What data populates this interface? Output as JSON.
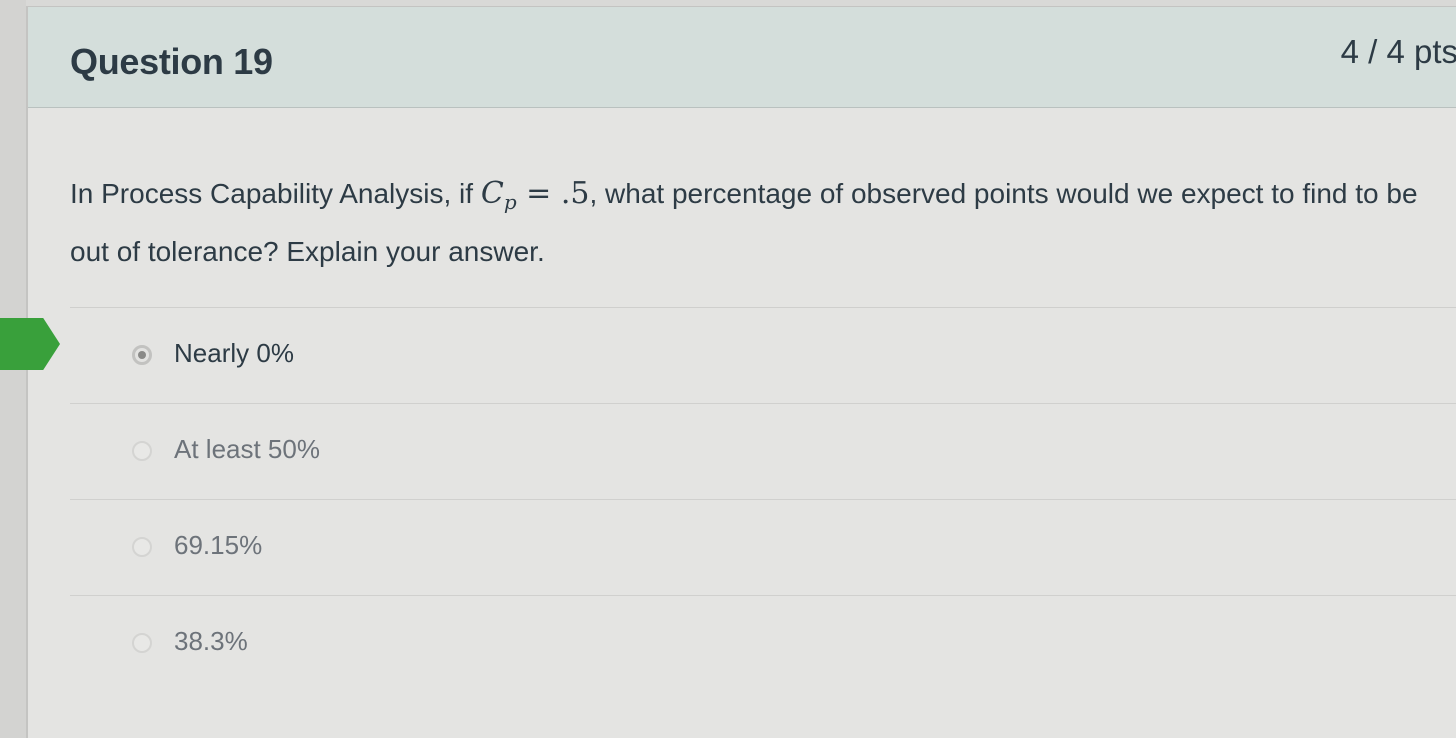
{
  "question": {
    "title": "Question 19",
    "points": "4 / 4 pts",
    "text_before_math": "In Process Capability Analysis, if ",
    "math_symbol": "C",
    "math_subscript": "p",
    "math_rest": " = .5",
    "text_after_math": ", what percentage of observed points would we expect to find to be out of tolerance? Explain your answer."
  },
  "answers": [
    {
      "label": "Nearly 0%",
      "selected": true
    },
    {
      "label": "At least 50%",
      "selected": false
    },
    {
      "label": "69.15%",
      "selected": false
    },
    {
      "label": "38.3%",
      "selected": false
    }
  ],
  "colors": {
    "correct_flag": "#39a03b",
    "header_bg": "#d4dedb",
    "text": "#2d3b45"
  },
  "icons": {
    "correct_marker": "correct-answer-arrow-icon"
  }
}
